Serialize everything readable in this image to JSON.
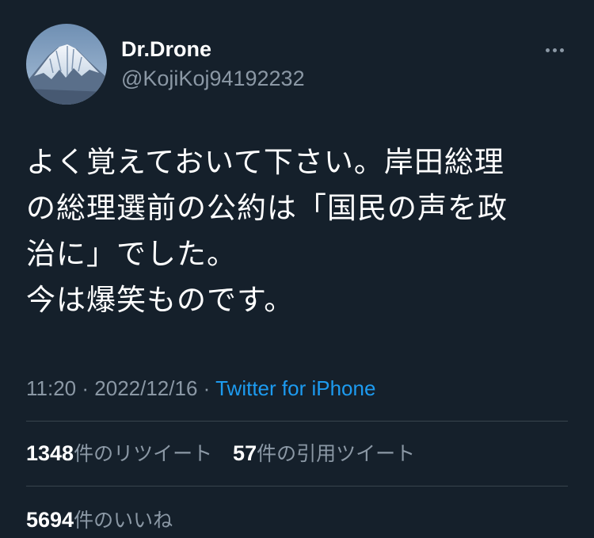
{
  "author": {
    "display_name": "Dr.Drone",
    "handle": "@KojiKoj94192232",
    "avatar_icon": "mount-fuji-avatar"
  },
  "more_icon": "more-options-icon",
  "tweet": {
    "lines": [
      "よく覚えておいて下さい。岸田総理",
      "の総理選前の公約は「国民の声を政",
      "治に」でした。",
      "今は爆笑ものです。"
    ]
  },
  "meta": {
    "time": "11:20",
    "separator": "·",
    "date": "2022/12/16",
    "source": "Twitter for iPhone"
  },
  "stats": {
    "retweets": {
      "count": "1348",
      "label": "件のリツイート"
    },
    "quotes": {
      "count": "57",
      "label": "件の引用ツイート"
    },
    "likes": {
      "count": "5694",
      "label": "件のいいね"
    }
  },
  "colors": {
    "background": "#15202b",
    "text": "#ffffff",
    "secondary": "#8b98a5",
    "link": "#1d9bf0",
    "divider": "#38444d"
  }
}
